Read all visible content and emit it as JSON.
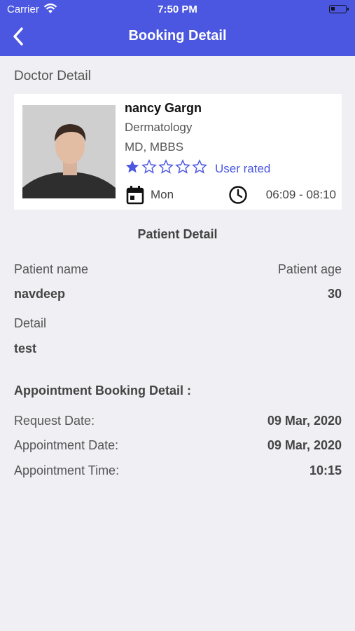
{
  "status_bar": {
    "carrier": "Carrier",
    "time": "7:50 PM"
  },
  "header": {
    "title": "Booking Detail",
    "back_icon": "chevron-left-icon"
  },
  "colors": {
    "accent": "#4b57e0",
    "background": "#efeff4"
  },
  "doctor_section": {
    "label": "Doctor Detail",
    "doctor": {
      "name": "nancy Gargn",
      "specialty": "Dermatology",
      "degree": "MD, MBBS",
      "rating": 1,
      "rating_max": 5,
      "rating_text": "User rated",
      "day": "Mon",
      "time_range": "06:09 - 08:10"
    }
  },
  "patient_section": {
    "heading": "Patient Detail",
    "name_label": "Patient name",
    "age_label": "Patient age",
    "name_value": "navdeep",
    "age_value": "30",
    "detail_label": "Detail",
    "detail_value": "test"
  },
  "appointment_section": {
    "heading": "Appointment Booking Detail :",
    "request_date_label": "Request Date:",
    "request_date_value": "09 Mar, 2020",
    "appointment_date_label": "Appointment Date:",
    "appointment_date_value": "09 Mar, 2020",
    "appointment_time_label": "Appointment Time:",
    "appointment_time_value": "10:15"
  }
}
